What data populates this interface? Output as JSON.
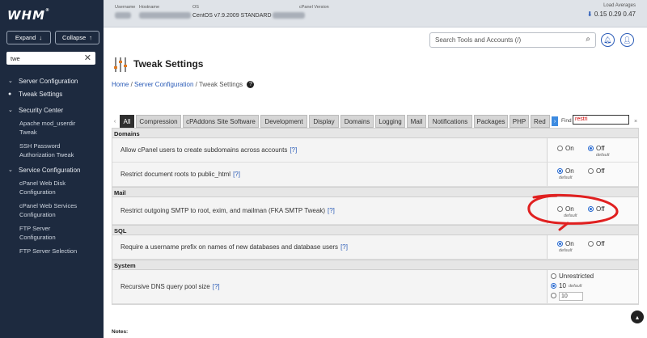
{
  "app": {
    "logo": "WHM",
    "logo_sup": "®"
  },
  "sidebar": {
    "expand_label": "Expand",
    "collapse_label": "Collapse",
    "search_value": "twe",
    "groups": [
      {
        "label": "Server Configuration",
        "items": []
      },
      {
        "label": "Tweak Settings",
        "items": []
      },
      {
        "label": "Security Center",
        "items": [
          "Apache mod_userdir",
          "Tweak",
          "SSH Password",
          "Authorization Tweak"
        ]
      },
      {
        "label": "Service Configuration",
        "items": [
          "cPanel Web Disk",
          "Configuration",
          "cPanel Web Services",
          "Configuration",
          "FTP Server",
          "Configuration",
          "FTP Server Selection"
        ]
      }
    ]
  },
  "topbar": {
    "username_label": "Username",
    "hostname_label": "Hostname",
    "os_label": "OS",
    "os_value": "CentOS v7.9.2009 STANDARD",
    "cpanel_label": "cPanel Version",
    "load_label": "Load Averages",
    "load_values": "0.15  0.29  0.47"
  },
  "search": {
    "placeholder": "Search Tools and Accounts (/)"
  },
  "page": {
    "title": "Tweak Settings",
    "breadcrumb": {
      "home": "Home",
      "section": "Server Configuration",
      "current": "Tweak Settings"
    }
  },
  "tabs": {
    "items": [
      "All",
      "Compression",
      "cPAddons Site Software",
      "Development",
      "Display",
      "Domains",
      "Logging",
      "Mail",
      "Notifications",
      "Packages",
      "PHP",
      "Red"
    ],
    "active": "All",
    "find_label": "Find",
    "find_value": "restri"
  },
  "sections": [
    {
      "title": "Domains"
    },
    {
      "title": "Mail"
    },
    {
      "title": "SQL"
    },
    {
      "title": "System"
    }
  ],
  "settings": [
    {
      "label": "Allow cPanel users to create subdomains across accounts",
      "help": "[?]",
      "on": "On",
      "off": "Off",
      "selected": "off",
      "default": "default"
    },
    {
      "label": "Restrict document roots to public_html",
      "help": "[?]",
      "on": "On",
      "off": "Off",
      "selected": "on",
      "default": "default"
    },
    {
      "label": "Restrict outgoing SMTP to root, exim, and mailman (FKA SMTP Tweak)",
      "help": "[?]",
      "on": "On",
      "off": "Off",
      "selected": "off",
      "default": "default"
    },
    {
      "label": "Require a username prefix on names of new databases and database users",
      "help": "[?]",
      "on": "On",
      "off": "Off",
      "selected": "on",
      "default": "default"
    },
    {
      "label": "Recursive DNS query pool size",
      "help": "[?]",
      "opt_unrestricted": "Unrestricted",
      "opt_value": "10",
      "opt_custom": "10",
      "selected": "10",
      "default": "default"
    }
  ],
  "notes_label": "Notes:",
  "colors": {
    "sidebar": "#1d2a3f",
    "accent": "#2a5bb7",
    "annotation": "#e02020"
  }
}
